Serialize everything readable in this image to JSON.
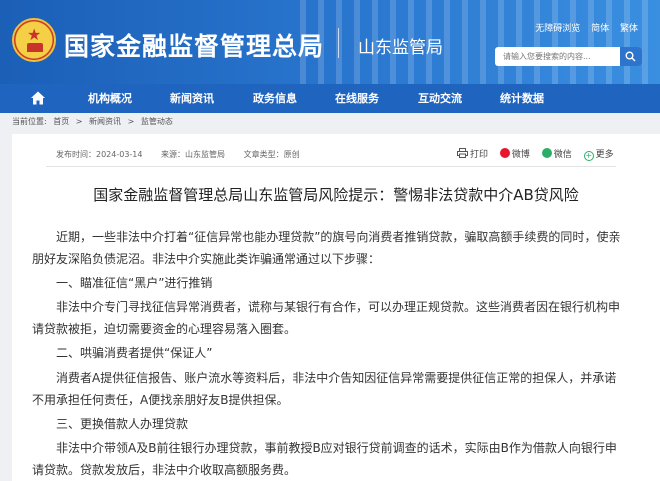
{
  "header": {
    "site_title": "国家金融监督管理总局",
    "sub_title": "山东监管局",
    "toplinks": [
      "无障碍浏览",
      "简体",
      "繁体"
    ],
    "search_placeholder": "请输入您要搜索的内容..."
  },
  "nav": {
    "items": [
      "机构概况",
      "新闻资讯",
      "政务信息",
      "在线服务",
      "互动交流",
      "统计数据"
    ]
  },
  "breadcrumb": {
    "label": "当前位置:",
    "items": [
      "首页",
      "新闻资讯",
      "监管动态"
    ],
    "separator": ">"
  },
  "article": {
    "date": "发布时间：2024-03-14",
    "source": "来源：山东监管局",
    "doctype": "文章类型：原创",
    "share": [
      "打印",
      "微博",
      "微信",
      "更多"
    ],
    "title": "国家金融监督管理总局山东监管局风险提示：警惕非法贷款中介AB贷风险",
    "paragraphs": [
      "近期，一些非法中介打着“征信异常也能办理贷款”的旗号向消费者推销贷款，骗取高额手续费的同时，使亲朋好友深陷负债泥沼。非法中介实施此类诈骗通常通过以下步骤：",
      "一、瞄准征信“黑户”进行推销",
      "非法中介专门寻找征信异常消费者，谎称与某银行有合作，可以办理正规贷款。这些消费者因在银行机构申请贷款被拒，迫切需要资金的心理容易落入圈套。",
      "二、哄骗消费者提供“保证人”",
      "消费者A提供征信报告、账户流水等资料后，非法中介告知因征信异常需要提供征信正常的担保人，并承诺不用承担任何责任，A便找亲朋好友B提供担保。",
      "三、更换借款人办理贷款",
      "非法中介带领A及B前往银行办理贷款，事前教授B应对银行贷前调查的话术，实际由B作为借款人向银行申请贷款。贷款发放后，非法中介收取高额服务费。"
    ]
  },
  "colors": {
    "header_blue": "#1b5fb7",
    "nav_blue": "#1f64bf",
    "page_bg": "#eef0f3"
  }
}
